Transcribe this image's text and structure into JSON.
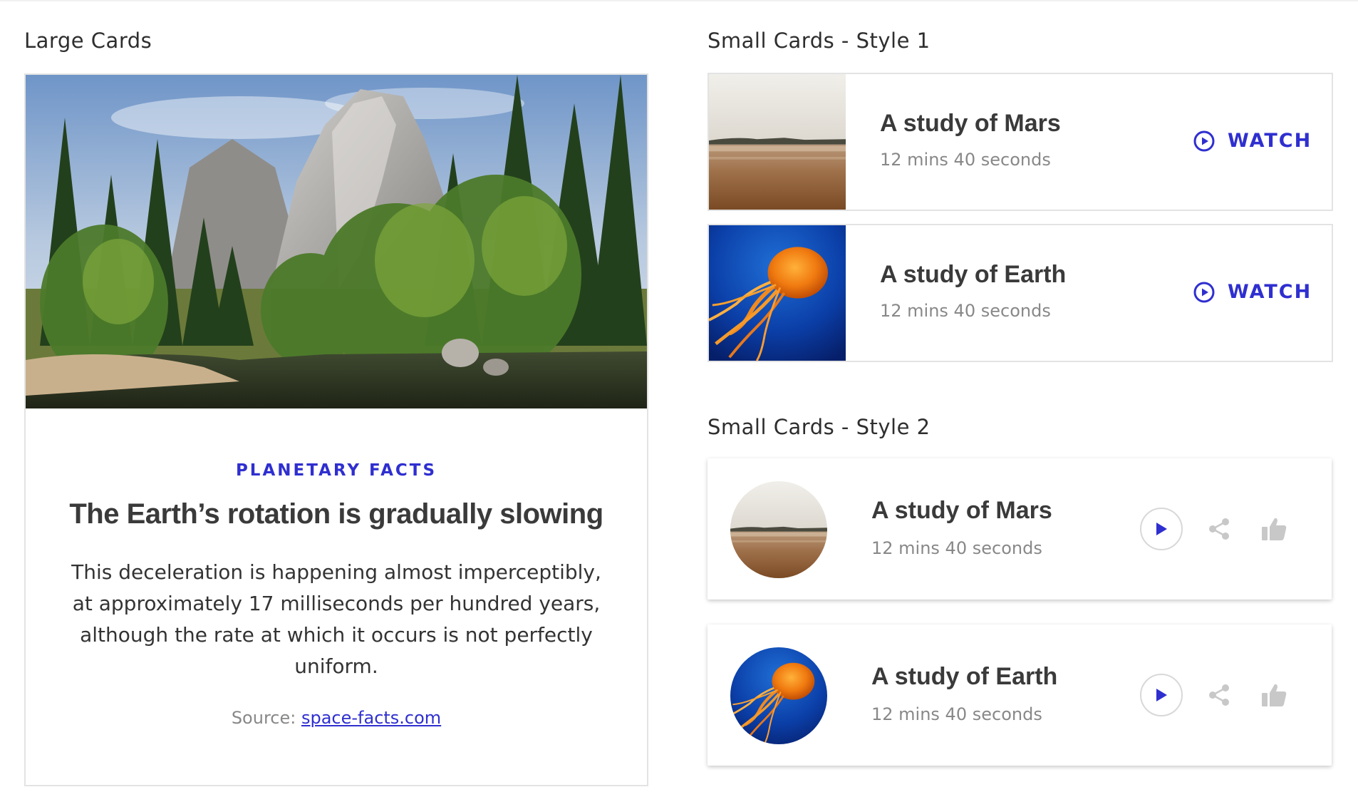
{
  "sections": {
    "large_cards_title": "Large Cards",
    "small_style1_title": "Small Cards - Style 1",
    "small_style2_title": "Small Cards - Style 2"
  },
  "large_card": {
    "image": "forest-river-mountain-photo",
    "category": "PLANETARY FACTS",
    "headline": "The Earth’s rotation is gradually slowing",
    "body": "This deceleration is happening almost imperceptibly, at approximately 17 milliseconds per hundred years, although the rate at which it occurs is not perfectly uniform.",
    "source_prefix": "Source: ",
    "source_link": "space-facts.com"
  },
  "small_style1": [
    {
      "image": "beach-landscape-photo",
      "title": "A study of Mars",
      "duration": "12 mins 40 seconds",
      "action_label": "WATCH",
      "action_icon": "play-circle-icon"
    },
    {
      "image": "jellyfish-photo",
      "title": "A study of Earth",
      "duration": "12 mins 40 seconds",
      "action_label": "WATCH",
      "action_icon": "play-circle-icon"
    }
  ],
  "small_style2": [
    {
      "image": "beach-landscape-photo",
      "title": "A study of Mars",
      "duration": "12 mins 40 seconds",
      "icons": [
        "play-icon",
        "share-icon",
        "thumbs-up-icon"
      ]
    },
    {
      "image": "jellyfish-photo",
      "title": "A study of Earth",
      "duration": "12 mins 40 seconds",
      "icons": [
        "play-icon",
        "share-icon",
        "thumbs-up-icon"
      ]
    }
  ],
  "colors": {
    "accent": "#2f2fd0",
    "text_dark": "#3a3a3a",
    "text_muted": "#888888",
    "border": "#e3e3e3"
  }
}
